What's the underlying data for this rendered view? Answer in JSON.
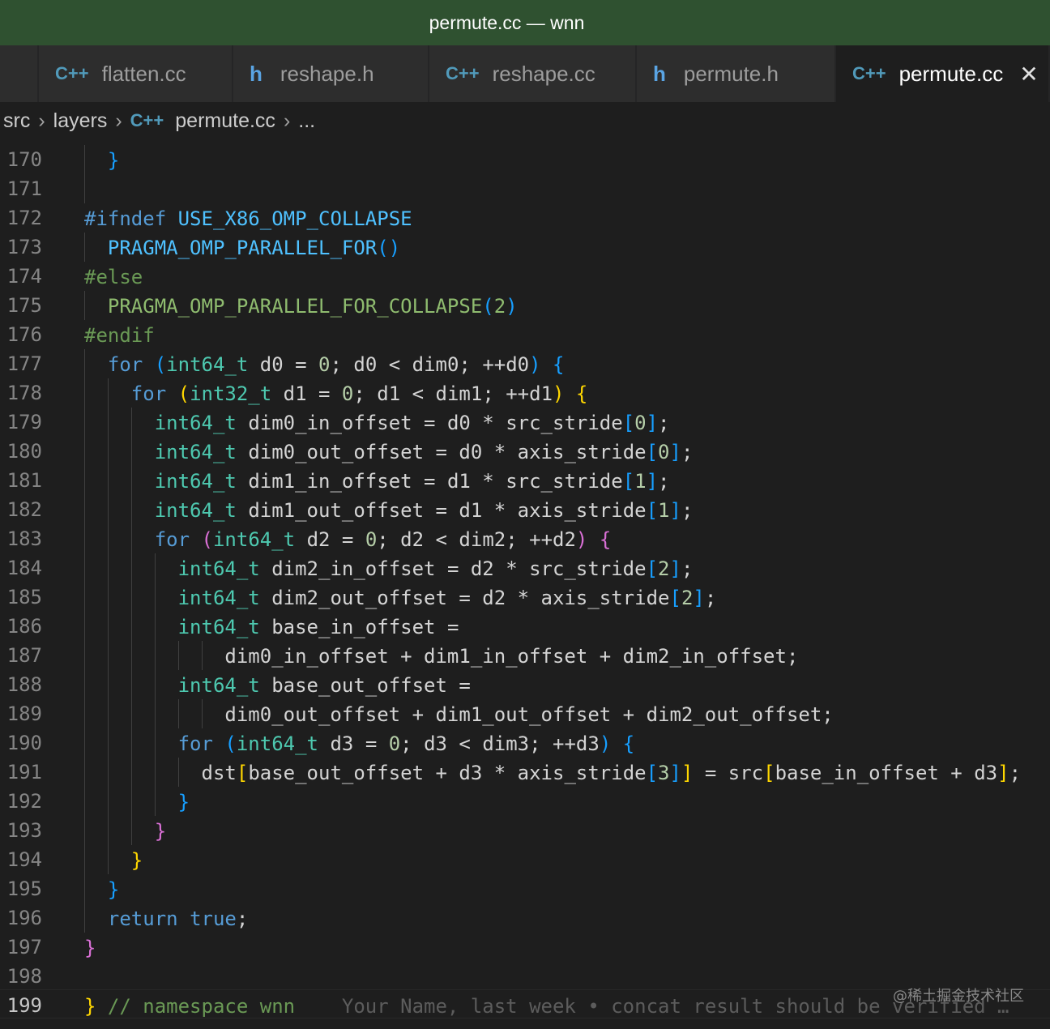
{
  "window": {
    "title": "permute.cc — wnn"
  },
  "tabs": [
    {
      "icon": "C++",
      "label": "flatten.cc"
    },
    {
      "icon": "h",
      "label": "reshape.h"
    },
    {
      "icon": "C++",
      "label": "reshape.cc"
    },
    {
      "icon": "h",
      "label": "permute.h"
    },
    {
      "icon": "C++",
      "label": "permute.cc",
      "close": "✕"
    }
  ],
  "breadcrumb": {
    "items": [
      "src",
      "layers",
      "permute.cc",
      "..."
    ],
    "file_icon": "C++"
  },
  "editor": {
    "line_numbers": [
      "170",
      "171",
      "172",
      "173",
      "174",
      "175",
      "176",
      "177",
      "178",
      "179",
      "180",
      "181",
      "182",
      "183",
      "184",
      "185",
      "186",
      "187",
      "188",
      "189",
      "190",
      "191",
      "192",
      "193",
      "194",
      "195",
      "196",
      "197",
      "198",
      "199"
    ],
    "blame": "Your Name, last week • concat result should be verified …"
  },
  "watermark": "@稀土掘金技术社区",
  "colors": {
    "titlebar": "#2f5130",
    "editor_bg": "#1e1e1e",
    "keyword": "#569cd6",
    "type": "#4ec9b0"
  }
}
